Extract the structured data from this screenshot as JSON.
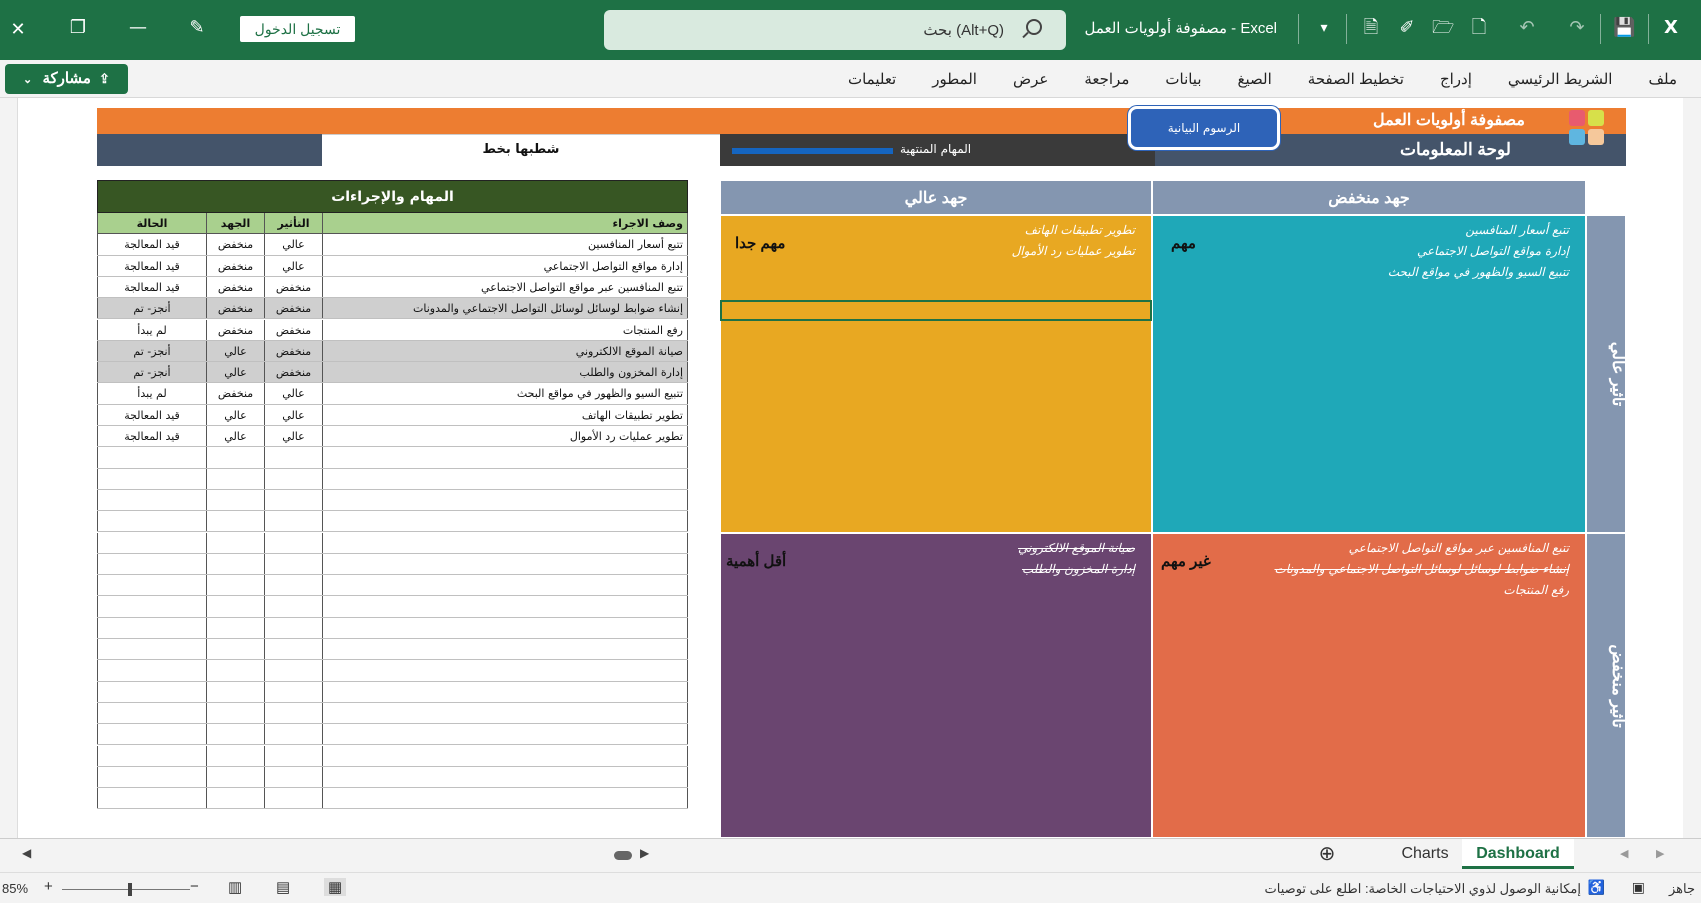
{
  "titlebar": {
    "doc_title": "مصفوفة أولويات العمل  -  Excel",
    "search_text": "بحث (Alt+Q)",
    "signin_label": "تسجيل الدخول"
  },
  "ribbon": {
    "share_label": "مشاركة",
    "menu": [
      "ملف",
      "الشريط الرئيسي",
      "إدراج",
      "تخطيط الصفحة",
      "الصيغ",
      "بيانات",
      "مراجعة",
      "عرض",
      "المطور",
      "تعليمات"
    ]
  },
  "dashboard": {
    "banner_title": "مصفوفة أولويات العمل",
    "info_title": "لوحة المعلومات",
    "charts_button": "الرسوم البيانية",
    "finished_tasks_label": "المهام المنتهية",
    "strikethrough_label": "شطبها بخط",
    "finished_progress": 0.37
  },
  "tasks": {
    "title": "المهام والإجراءات",
    "columns": [
      "وصف الاجراء",
      "التأثير",
      "الجهد",
      "الحالة"
    ],
    "rows": [
      [
        "تتبع أسعار المنافسين",
        "عالي",
        "منخفض",
        "قيد المعالجة",
        false
      ],
      [
        "إدارة مواقع التواصل الاجتماعي",
        "عالي",
        "منخفض",
        "قيد المعالجة",
        false
      ],
      [
        "تتبع المنافسين عبر مواقع التواصل الاجتماعي",
        "منخفض",
        "منخفض",
        "قيد المعالجة",
        false
      ],
      [
        "إنشاء ضوابط لوسائل لوسائل التواصل الاجتماعي والمدونات",
        "منخفض",
        "منخفض",
        "أنجز- تم",
        true
      ],
      [
        "رفع المنتجات",
        "منخفض",
        "منخفض",
        "لم يبدأ",
        false
      ],
      [
        "صيانة الموقع الالكتروني",
        "منخفض",
        "عالي",
        "أنجز- تم",
        true
      ],
      [
        "إدارة المخزون والطلب",
        "منخفض",
        "عالي",
        "أنجز- تم",
        true
      ],
      [
        "تتبيع السيو والظهور في مواقع البحث",
        "عالي",
        "منخفض",
        "لم يبدأ",
        false
      ],
      [
        "تطوير تطبيقات الهاتف",
        "عالي",
        "عالي",
        "قيد المعالجة",
        false
      ],
      [
        "تطوير عمليات رد الأموال",
        "عالي",
        "عالي",
        "قيد المعالجة",
        false
      ]
    ]
  },
  "matrix": {
    "col_low_effort": "جهد منخفض",
    "col_high_effort": "جهد عالي",
    "row_high_impact": "تأثير عالي",
    "row_low_impact": "تأثير منخفض",
    "q_important": {
      "label": "مهم",
      "items": [
        "تتبع أسعار المنافسين",
        "إدارة مواقع التواصل الاجتماعي",
        "تتبيع السيو والظهور في مواقع البحث"
      ],
      "color": "#1fa8b8"
    },
    "q_very_important": {
      "label": "مهم جدا",
      "items": [
        "تطوير تطبيقات الهاتف",
        "تطوير عمليات رد الأموال"
      ],
      "color": "#e8a822"
    },
    "q_not_important": {
      "label": "غير مهم",
      "items": [
        "تتبع المنافسين عبر مواقع التواصل الاجتماعي",
        "إنشاء ضوابط لوسائل لوسائل التواصل الاجتماعي والمدونات",
        "رفع المنتجات"
      ],
      "color": "#e26c49"
    },
    "q_less_important": {
      "label": "أقل أهمية",
      "items": [
        "صيانة الموقع الالكتروني",
        "إدارة المخزون والطلب"
      ],
      "color": "#6a4570"
    }
  },
  "sheet_tabs": {
    "tabs": [
      "Dashboard",
      "Charts"
    ],
    "active": "Dashboard"
  },
  "statusbar": {
    "ready": "جاهز",
    "accessibility": "إمكانية الوصول لذوي الاحتياجات الخاصة: اطلع على توصيات",
    "zoom": "85%"
  },
  "colors": {
    "excel_green": "#1e7145",
    "orange": "#ed7d31",
    "slate": "#44546a",
    "header_blue_grey": "#8496b0",
    "table_header_dark_green": "#375623",
    "table_header_light_green": "#a9d08e"
  }
}
